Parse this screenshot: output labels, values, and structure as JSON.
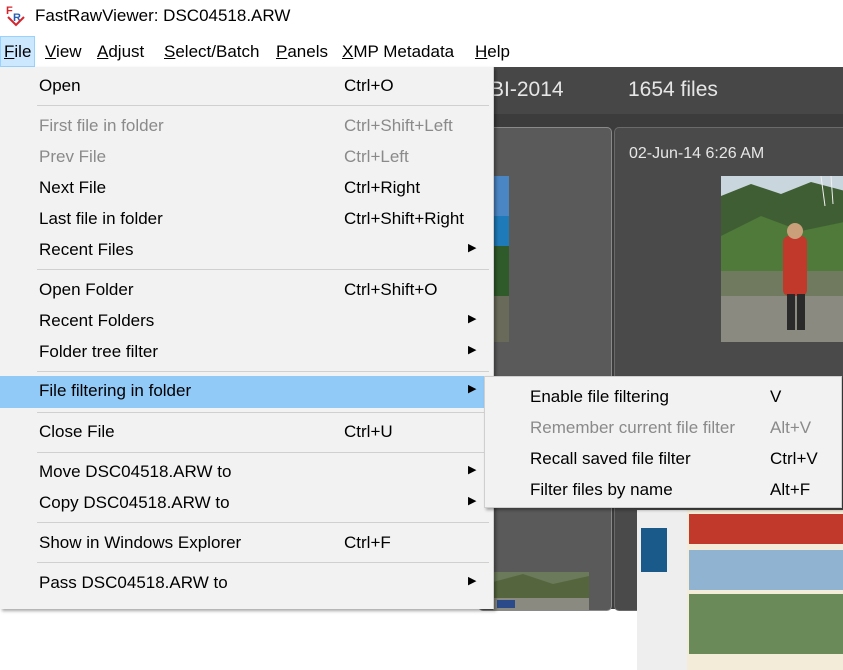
{
  "window": {
    "title": "FastRawViewer: DSC04518.ARW"
  },
  "menubar": [
    {
      "label": "File",
      "mnemonic": "F",
      "rest": "ile",
      "active": true
    },
    {
      "label": "View",
      "mnemonic": "V",
      "rest": "iew"
    },
    {
      "label": "Adjust",
      "mnemonic": "A",
      "rest": "djust"
    },
    {
      "label": "Select/Batch",
      "mnemonic": "S",
      "rest": "elect/Batch"
    },
    {
      "label": "Panels",
      "mnemonic": "P",
      "rest": "anels"
    },
    {
      "label": "XMP Metadata",
      "mnemonic": "X",
      "rest": "MP Metadata"
    },
    {
      "label": "Help",
      "mnemonic": "H",
      "rest": "elp"
    }
  ],
  "browser": {
    "folder_name": "BI-2014",
    "file_count": "1654 files",
    "thumbnail_date": "02-Jun-14 6:26 AM"
  },
  "file_menu": {
    "open": {
      "label": "Open",
      "shortcut": "Ctrl+O"
    },
    "first_file": {
      "label": "First file in folder",
      "shortcut": "Ctrl+Shift+Left",
      "disabled": true
    },
    "prev_file": {
      "label": "Prev File",
      "shortcut": "Ctrl+Left",
      "disabled": true
    },
    "next_file": {
      "label": "Next File",
      "shortcut": "Ctrl+Right"
    },
    "last_file": {
      "label": "Last file in folder",
      "shortcut": "Ctrl+Shift+Right"
    },
    "recent_files": {
      "label": "Recent Files",
      "submenu": true
    },
    "open_folder": {
      "label": "Open Folder",
      "shortcut": "Ctrl+Shift+O"
    },
    "recent_folders": {
      "label": "Recent Folders",
      "submenu": true
    },
    "folder_tree_filter": {
      "label": "Folder tree filter",
      "submenu": true
    },
    "file_filtering": {
      "label": "File filtering in folder",
      "submenu": true,
      "highlighted": true
    },
    "close_file": {
      "label": "Close File",
      "shortcut": "Ctrl+U"
    },
    "move_file": {
      "label": "Move DSC04518.ARW to",
      "submenu": true
    },
    "copy_file": {
      "label": "Copy DSC04518.ARW to",
      "submenu": true
    },
    "show_in_explorer": {
      "label": "Show in Windows Explorer",
      "shortcut": "Ctrl+F"
    },
    "pass_file": {
      "label": "Pass DSC04518.ARW to",
      "submenu": true
    }
  },
  "filter_submenu": {
    "enable": {
      "label": "Enable file filtering",
      "shortcut": "V"
    },
    "remember": {
      "label": "Remember current file filter",
      "shortcut": "Alt+V",
      "disabled": true
    },
    "recall": {
      "label": "Recall saved file filter",
      "shortcut": "Ctrl+V"
    },
    "by_name": {
      "label": "Filter files by name",
      "shortcut": "Alt+F"
    }
  },
  "icons": {
    "submenu_arrow": "triangle-right-icon",
    "app_logo": "fastrawviewer-logo"
  },
  "colors": {
    "highlight": "#91c9f7",
    "menu_bg": "#f2f2f2",
    "disabled_text": "#8a8a8a",
    "active_menubar": "#cce8ff",
    "viewer_bg": "#3c3c3c"
  }
}
